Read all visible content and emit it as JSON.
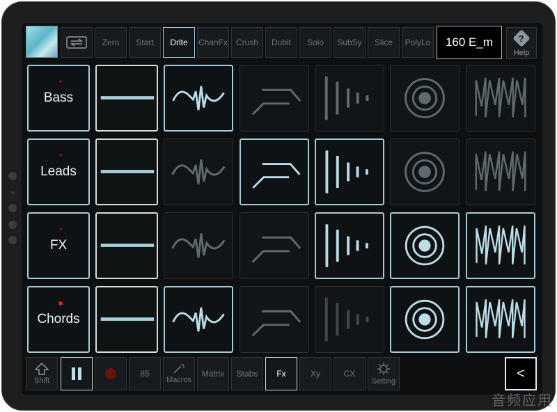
{
  "top_buttons": {
    "swap_icon": "swap-arrows-icon",
    "zero": "Zero",
    "start": "Start",
    "drlte": "Drlte",
    "chanfx": "ChanFx",
    "crush": "Crush",
    "dublt": "Dublt",
    "solo": "Solo",
    "subsy": "SubSy",
    "slice": "Slice",
    "polylo": "PolyLo"
  },
  "tempo_display": "160 E_m",
  "help_label": "Help",
  "rows": [
    {
      "label": "Bass",
      "record_dot": "dim"
    },
    {
      "label": "Leads",
      "record_dot": "dim"
    },
    {
      "label": "FX",
      "record_dot": "dim"
    },
    {
      "label": "Chords",
      "record_dot": "on"
    }
  ],
  "bottom_buttons": {
    "shift": "Shift",
    "pause_icon": "pause-icon",
    "record_icon": "record-icon",
    "count": "85",
    "macros": "Macros",
    "matrix": "Matrix",
    "stabs": "Stabs",
    "fx": "Fx",
    "xy": "Xy",
    "cx": "CX",
    "setting": "Setting",
    "back": "<"
  },
  "watermark": "音频应用",
  "colors": {
    "accent": "#a6ccd9",
    "record": "#e01f1f",
    "screen": "#0d0f10"
  }
}
